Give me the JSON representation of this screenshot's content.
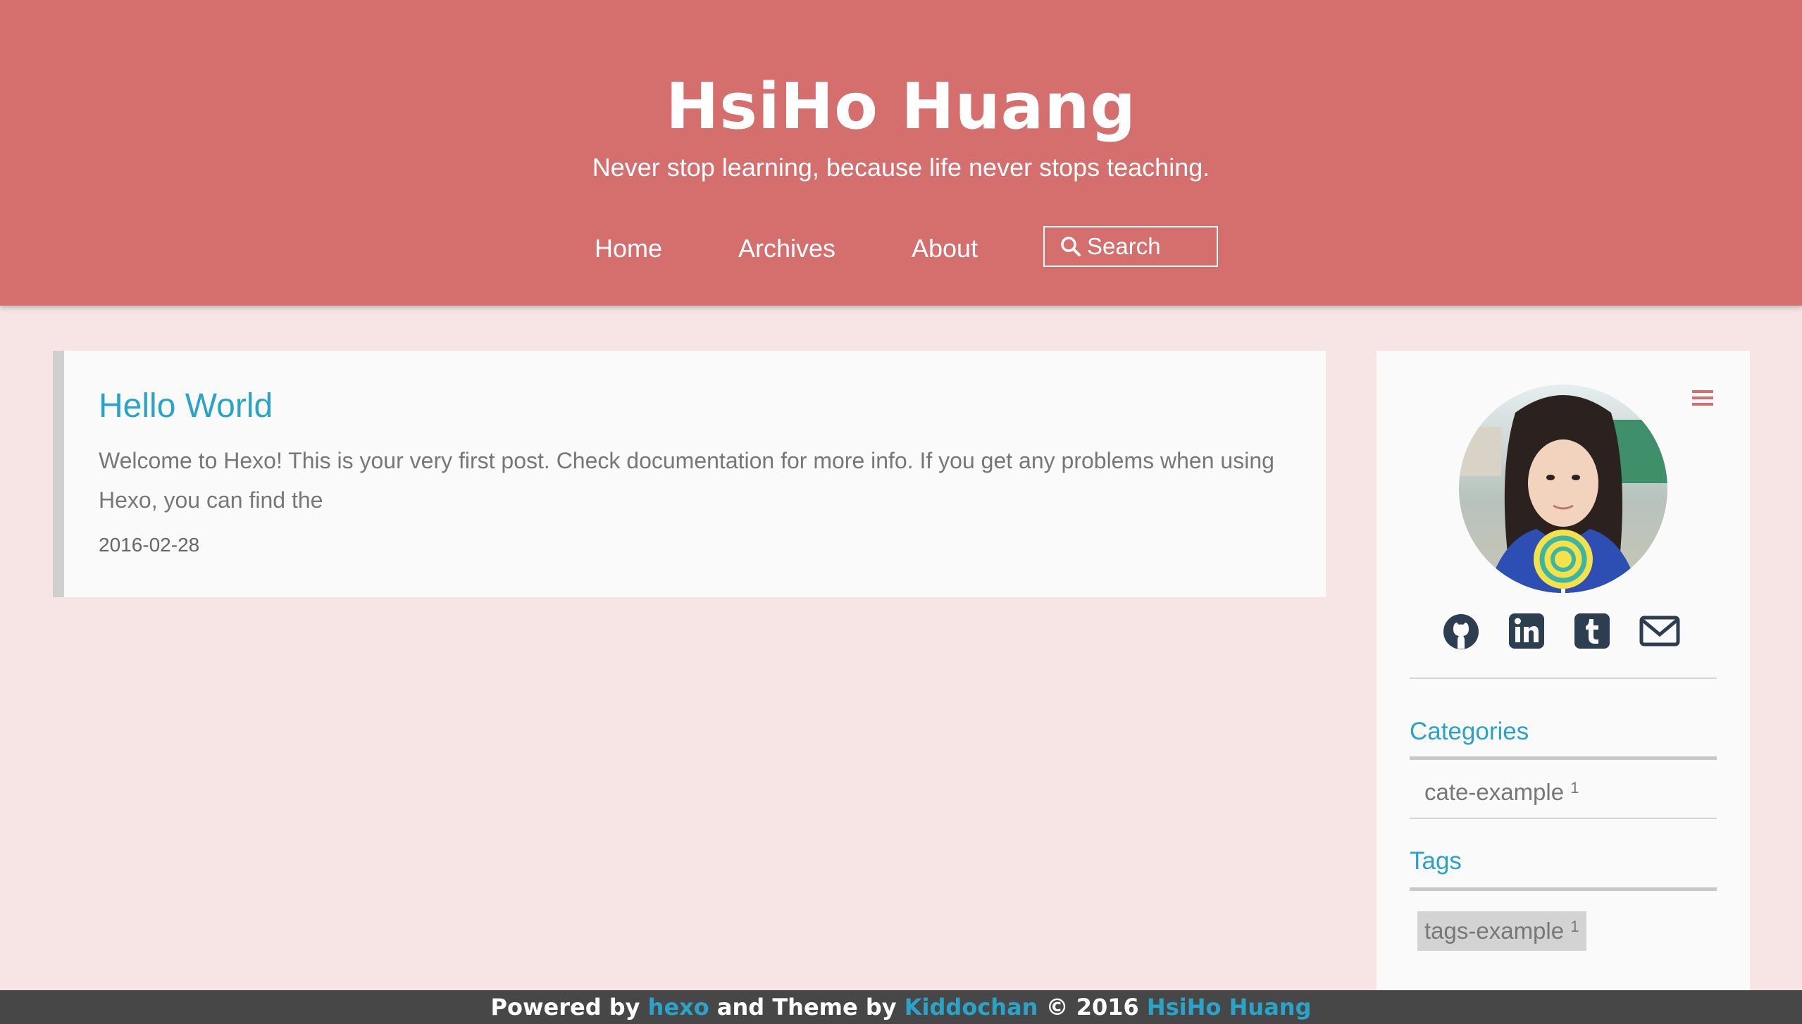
{
  "site": {
    "title": "HsiHo Huang",
    "subtitle": "Never stop learning, because life never stops teaching."
  },
  "nav": {
    "home": "Home",
    "archives": "Archives",
    "about": "About",
    "search_placeholder": "Search"
  },
  "post": {
    "title": "Hello World",
    "excerpt": "Welcome to Hexo! This is your very first post. Check documentation for more info. If you get any problems when using Hexo, you can find the",
    "date": "2016-02-28"
  },
  "sidebar": {
    "social_icons": [
      "github-icon",
      "linkedin-icon",
      "tumblr-icon",
      "mail-icon"
    ],
    "categories_heading": "Categories",
    "categories": [
      {
        "name": "cate-example",
        "count": "1"
      }
    ],
    "tags_heading": "Tags",
    "tags": [
      {
        "name": "tags-example",
        "count": "1"
      }
    ]
  },
  "footer": {
    "powered_by": "Powered by",
    "hexo": "hexo",
    "theme_by": "and Theme by",
    "theme_author": "Kiddochan",
    "copyright": "© 2016",
    "owner": "HsiHo Huang"
  },
  "colors": {
    "header": "#d46f6e",
    "accent": "#2aa3c8",
    "background": "#f7e5e5",
    "footer": "#474747"
  }
}
